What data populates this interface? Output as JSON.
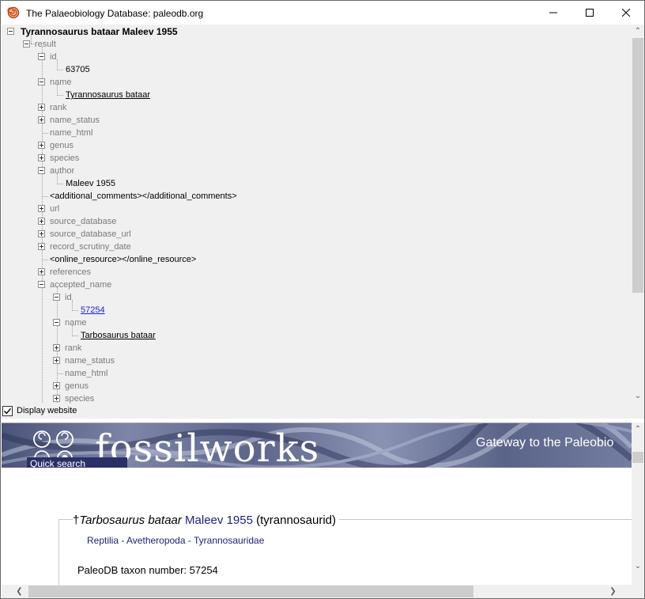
{
  "window": {
    "title": "The Palaeobiology Database: paleodb.org"
  },
  "tree": {
    "root": "Tyrannosaurus bataar Maleev 1955",
    "result": "result",
    "id_key": "id",
    "id_val": "63705",
    "name_key": "name",
    "name_val": "Tyrannosaurus bataar",
    "rank": "rank",
    "name_status": "name_status",
    "name_html": "name_html",
    "genus": "genus",
    "species": "species",
    "author_key": "author",
    "author_val": "Maleev 1955",
    "additional_comments": "<additional_comments></additional_comments>",
    "url": "url",
    "source_database": "source_database",
    "source_database_url": "source_database_url",
    "record_scrutiny_date": "record_scrutiny_date",
    "online_resource": "<online_resource></online_resource>",
    "references": "references",
    "accepted_name": "accepted_name",
    "acc_id_key": "id",
    "acc_id_val": "57254",
    "acc_name_key": "name",
    "acc_name_val": "Tarbosaurus bataar",
    "acc_rank": "rank",
    "acc_name_status": "name_status",
    "acc_name_html": "name_html",
    "acc_genus": "genus",
    "acc_species": "species"
  },
  "display_website": {
    "label": "Display website",
    "checked": true
  },
  "website": {
    "logo": "fossilworks",
    "tagline": "Gateway to the Paleobio",
    "quick_search": "Quick search",
    "heading_dagger": "†",
    "heading_name": "Tarbosaurus bataar",
    "heading_author": "Maleev 1955",
    "heading_group": "(tyrannosaurid)",
    "classification": "Reptilia - Avetheropoda - Tyrannosauridae",
    "taxon_number": "PaleoDB taxon number: 57254"
  },
  "icons": [
    "app-icon",
    "minimize-icon",
    "maximize-icon",
    "close-icon",
    "scroll-up-icon",
    "scroll-down-icon",
    "scroll-left-icon",
    "scroll-right-icon",
    "checkmark-icon"
  ]
}
